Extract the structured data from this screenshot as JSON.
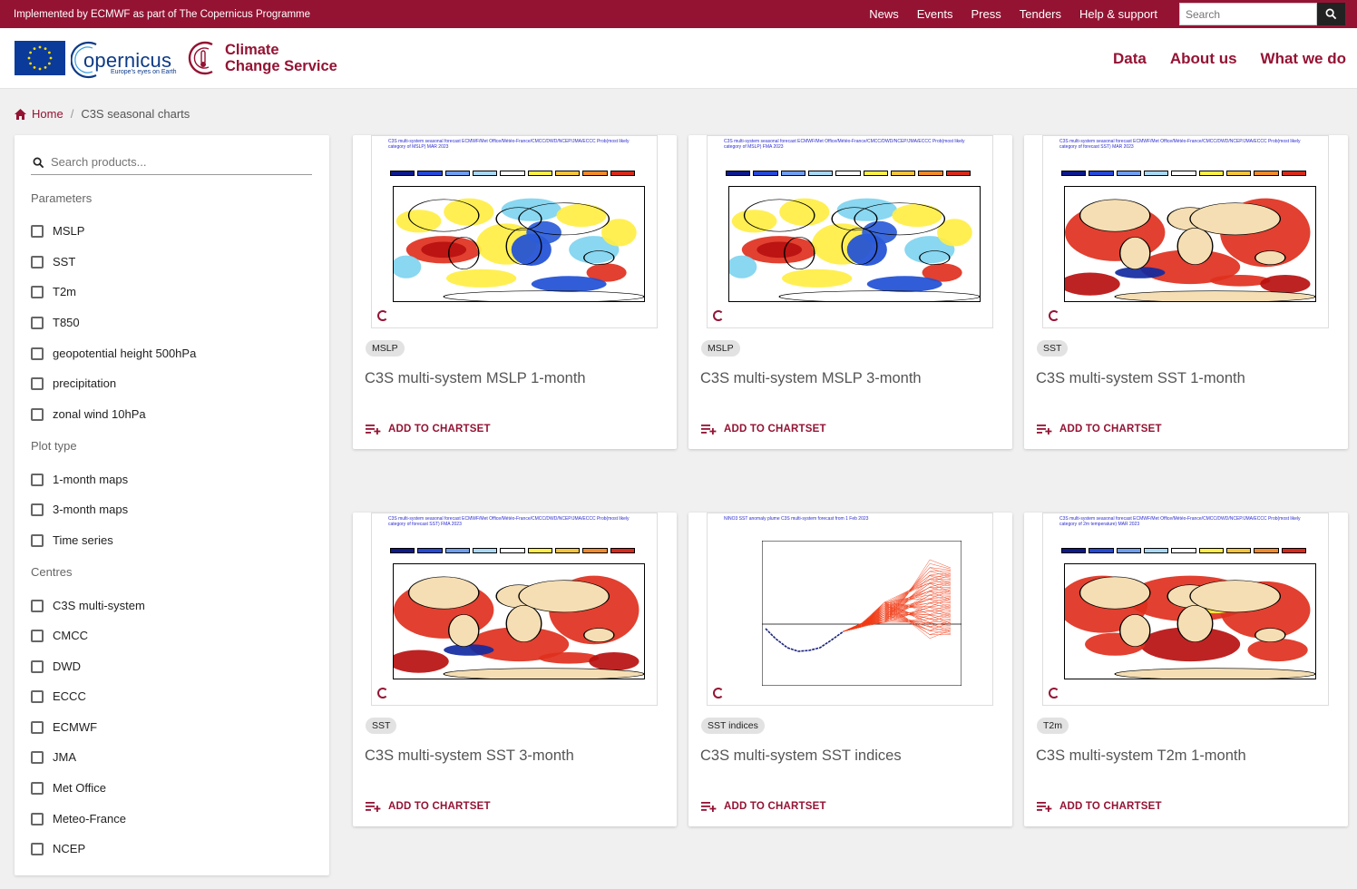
{
  "topbar": {
    "tagline": "Implemented by ECMWF as part of The Copernicus Programme",
    "links": [
      "News",
      "Events",
      "Press",
      "Tenders",
      "Help & support"
    ],
    "search_placeholder": "Search"
  },
  "header": {
    "copernicus_word": "opernicus",
    "copernicus_sub": "Europe's eyes on Earth",
    "service_line1": "Climate",
    "service_line2": "Change Service",
    "nav": [
      "Data",
      "About us",
      "What we do"
    ]
  },
  "breadcrumb": {
    "home": "Home",
    "current": "C3S seasonal charts"
  },
  "sidebar": {
    "search_placeholder": "Search products...",
    "groups": [
      {
        "title": "Parameters",
        "items": [
          "MSLP",
          "SST",
          "T2m",
          "T850",
          "geopotential height 500hPa",
          "precipitation",
          "zonal wind 10hPa"
        ]
      },
      {
        "title": "Plot type",
        "items": [
          "1-month maps",
          "3-month maps",
          "Time series"
        ]
      },
      {
        "title": "Centres",
        "items": [
          "C3S multi-system",
          "CMCC",
          "DWD",
          "ECCC",
          "ECMWF",
          "JMA",
          "Met Office",
          "Meteo-France",
          "NCEP"
        ]
      }
    ]
  },
  "add_label": "ADD TO CHARTSET",
  "cards": [
    {
      "tag": "MSLP",
      "title": "C3S multi-system MSLP 1-month",
      "kind": "map",
      "palette": "mslp",
      "thumb_title": "C3S multi-system seasonal forecast   ECMWF/Met Office/Météo-France/CMCC/DWD/NCEP/JMA/ECCC   Prob(most likely category of MSLP)   MAR 2023"
    },
    {
      "tag": "MSLP",
      "title": "C3S multi-system MSLP 3-month",
      "kind": "map",
      "palette": "mslp",
      "thumb_title": "C3S multi-system seasonal forecast   ECMWF/Met Office/Météo-France/CMCC/DWD/NCEP/JMA/ECCC   Prob(most likely category of MSLP)   FMA 2023"
    },
    {
      "tag": "SST",
      "title": "C3S multi-system SST 1-month",
      "kind": "map",
      "palette": "sst",
      "thumb_title": "C3S multi-system seasonal forecast   ECMWF/Met Office/Météo-France/CMCC/DWD/NCEP/JMA/ECCC   Prob(most likely category of forecast SST)   MAR 2023"
    },
    {
      "tag": "SST",
      "title": "C3S multi-system SST 3-month",
      "kind": "map",
      "palette": "sst",
      "thumb_title": "C3S multi-system seasonal forecast   ECMWF/Met Office/Météo-France/CMCC/DWD/NCEP/JMA/ECCC   Prob(most likely category of forecast SST)   FMA 2023"
    },
    {
      "tag": "SST indices",
      "title": "C3S multi-system SST indices",
      "kind": "plume",
      "thumb_title": "NINO3 SST anomaly plume   C3S multi-system forecast from 1 Feb 2023"
    },
    {
      "tag": "T2m",
      "title": "C3S multi-system T2m 1-month",
      "kind": "map",
      "palette": "t2m",
      "thumb_title": "C3S multi-system seasonal forecast   ECMWF/Met Office/Météo-France/CMCC/DWD/NCEP/JMA/ECCC   Prob(most likely category of 2m temperature)   MAR 2023"
    }
  ],
  "colors": {
    "brand": "#941333",
    "land": "#f5deb3",
    "warm": "#e0301e",
    "cool": "#1f4fd6",
    "yellow": "#ffee44",
    "cyan": "#7fd4f0"
  }
}
